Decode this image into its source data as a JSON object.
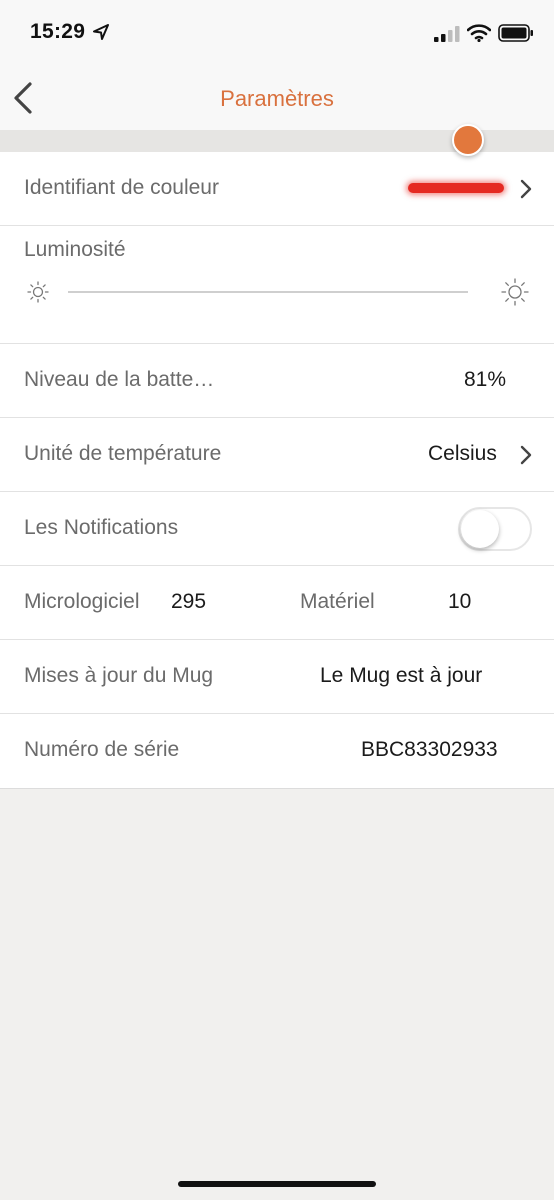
{
  "status_bar": {
    "time": "15:29",
    "icons": [
      "location-arrow-icon",
      "cellular-signal-icon",
      "wifi-icon",
      "battery-icon"
    ]
  },
  "nav": {
    "title": "Paramètres",
    "back_icon": "chevron-left-icon"
  },
  "colors": {
    "accent": "#d9713e",
    "slider_thumb": "#e2783d",
    "color_identifier": "#e52a22"
  },
  "settings": {
    "color_id": {
      "label": "Identifiant de couleur",
      "color": "#e52a22"
    },
    "brightness": {
      "label": "Luminosité",
      "level": 1.0
    },
    "battery": {
      "label": "Niveau de la batte…",
      "value": "81%"
    },
    "temperature": {
      "label": "Unité de température",
      "value": "Celsius"
    },
    "notifications": {
      "label": "Les Notifications",
      "enabled": false
    },
    "firmware": {
      "label": "Micrologiciel",
      "value": "295",
      "hardware_label": "Matériel",
      "hardware_value": "10"
    },
    "updates": {
      "label": "Mises à jour du Mug",
      "value": "Le Mug est à jour"
    },
    "serial": {
      "label": "Numéro de série",
      "value": "BBC83302933"
    }
  }
}
